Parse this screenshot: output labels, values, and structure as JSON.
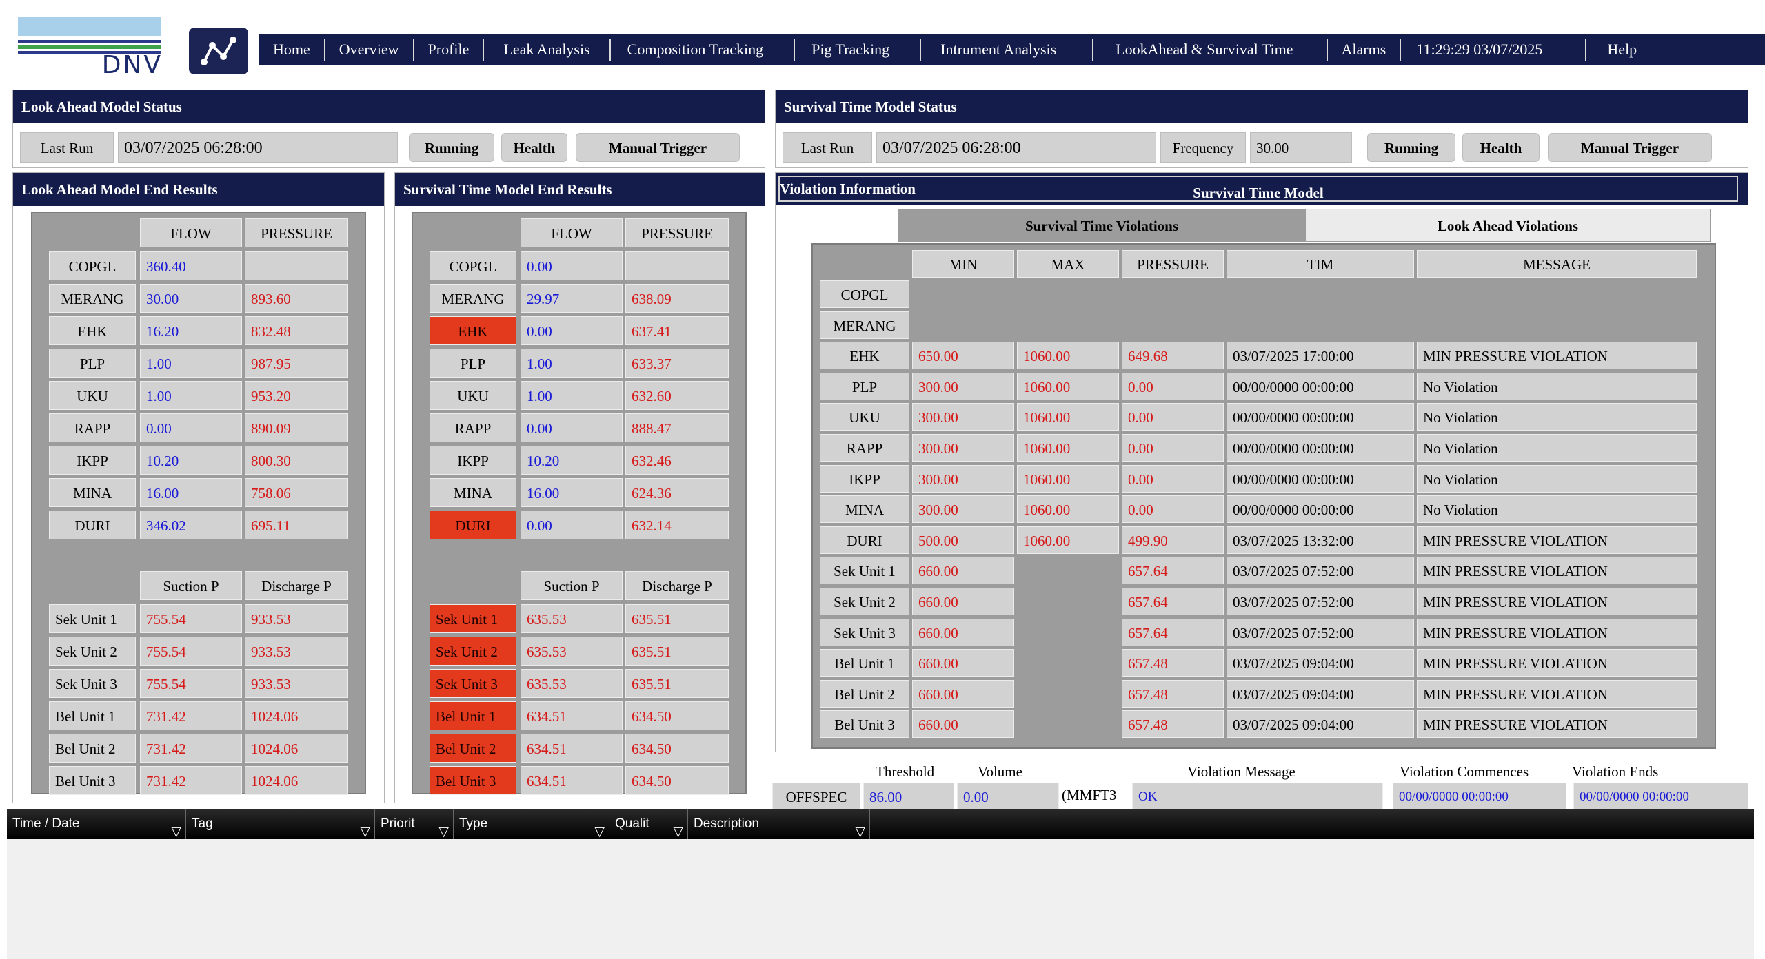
{
  "logo": {
    "text": "DNV"
  },
  "nav": [
    "Home",
    "Overview",
    "Profile",
    "Leak Analysis",
    "Composition Tracking",
    "Pig Tracking",
    "Intrument Analysis",
    "LookAhead & Survival Time",
    "Alarms",
    "11:29:29 03/07/2025",
    "Help"
  ],
  "la_status": {
    "title": "Look Ahead Model Status",
    "last_run_label": "Last Run",
    "last_run": "03/07/2025 06:28:00",
    "running": "Running",
    "health": "Health",
    "manual_trigger": "Manual Trigger"
  },
  "st_status": {
    "title": "Survival Time Model Status",
    "last_run_label": "Last Run",
    "last_run": "03/07/2025 06:28:00",
    "frequency_label": "Frequency",
    "frequency": "30.00",
    "running": "Running",
    "health": "Health",
    "manual_trigger": "Manual Trigger"
  },
  "la_results": {
    "title": "Look Ahead Model End Results",
    "flow_header": "FLOW",
    "pressure_header": "PRESSURE",
    "rows": [
      {
        "name": "COPGL",
        "flow": "360.40",
        "pressure": "",
        "alarm": false
      },
      {
        "name": "MERANG",
        "flow": "30.00",
        "pressure": "893.60",
        "alarm": false
      },
      {
        "name": "EHK",
        "flow": "16.20",
        "pressure": "832.48",
        "alarm": false
      },
      {
        "name": "PLP",
        "flow": "1.00",
        "pressure": "987.95",
        "alarm": false
      },
      {
        "name": "UKU",
        "flow": "1.00",
        "pressure": "953.20",
        "alarm": false
      },
      {
        "name": "RAPP",
        "flow": "0.00",
        "pressure": "890.09",
        "alarm": false
      },
      {
        "name": "IKPP",
        "flow": "10.20",
        "pressure": "800.30",
        "alarm": false
      },
      {
        "name": "MINA",
        "flow": "16.00",
        "pressure": "758.06",
        "alarm": false
      },
      {
        "name": "DURI",
        "flow": "346.02",
        "pressure": "695.11",
        "alarm": false
      }
    ],
    "suction_header": "Suction P",
    "discharge_header": "Discharge P",
    "units": [
      {
        "name": "Sek Unit 1",
        "suction": "755.54",
        "discharge": "933.53",
        "alarm": false
      },
      {
        "name": "Sek Unit 2",
        "suction": "755.54",
        "discharge": "933.53",
        "alarm": false
      },
      {
        "name": "Sek Unit 3",
        "suction": "755.54",
        "discharge": "933.53",
        "alarm": false
      },
      {
        "name": "Bel Unit 1",
        "suction": "731.42",
        "discharge": "1024.06",
        "alarm": false
      },
      {
        "name": "Bel Unit 2",
        "suction": "731.42",
        "discharge": "1024.06",
        "alarm": false
      },
      {
        "name": "Bel Unit 3",
        "suction": "731.42",
        "discharge": "1024.06",
        "alarm": false
      }
    ]
  },
  "st_results": {
    "title": "Survival Time Model End Results",
    "flow_header": "FLOW",
    "pressure_header": "PRESSURE",
    "rows": [
      {
        "name": "COPGL",
        "flow": "0.00",
        "pressure": "",
        "alarm": false
      },
      {
        "name": "MERANG",
        "flow": "29.97",
        "pressure": "638.09",
        "alarm": false
      },
      {
        "name": "EHK",
        "flow": "0.00",
        "pressure": "637.41",
        "alarm": true
      },
      {
        "name": "PLP",
        "flow": "1.00",
        "pressure": "633.37",
        "alarm": false
      },
      {
        "name": "UKU",
        "flow": "1.00",
        "pressure": "632.60",
        "alarm": false
      },
      {
        "name": "RAPP",
        "flow": "0.00",
        "pressure": "888.47",
        "alarm": false
      },
      {
        "name": "IKPP",
        "flow": "10.20",
        "pressure": "632.46",
        "alarm": false
      },
      {
        "name": "MINA",
        "flow": "16.00",
        "pressure": "624.36",
        "alarm": false
      },
      {
        "name": "DURI",
        "flow": "0.00",
        "pressure": "632.14",
        "alarm": true
      }
    ],
    "suction_header": "Suction P",
    "discharge_header": "Discharge P",
    "units": [
      {
        "name": "Sek Unit 1",
        "suction": "635.53",
        "discharge": "635.51",
        "alarm": true
      },
      {
        "name": "Sek Unit 2",
        "suction": "635.53",
        "discharge": "635.51",
        "alarm": true
      },
      {
        "name": "Sek Unit 3",
        "suction": "635.53",
        "discharge": "635.51",
        "alarm": true
      },
      {
        "name": "Bel Unit 1",
        "suction": "634.51",
        "discharge": "634.50",
        "alarm": true
      },
      {
        "name": "Bel Unit 2",
        "suction": "634.51",
        "discharge": "634.50",
        "alarm": true
      },
      {
        "name": "Bel Unit 3",
        "suction": "634.51",
        "discharge": "634.50",
        "alarm": true
      }
    ]
  },
  "violation": {
    "title": "Violation Information",
    "model_label": "Survival Time Model",
    "tab_active": "Survival Time Violations",
    "tab_inactive": "Look Ahead Violations",
    "headers": [
      "MIN",
      "MAX",
      "PRESSURE",
      "TIM",
      "MESSAGE"
    ],
    "rows": [
      {
        "name": "COPGL",
        "min": "",
        "max": "",
        "pressure": "",
        "time": "",
        "message": ""
      },
      {
        "name": "MERANG",
        "min": "",
        "max": "",
        "pressure": "",
        "time": "",
        "message": ""
      },
      {
        "name": "EHK",
        "min": "650.00",
        "max": "1060.00",
        "pressure": "649.68",
        "time": "03/07/2025 17:00:00",
        "message": "MIN PRESSURE VIOLATION"
      },
      {
        "name": "PLP",
        "min": "300.00",
        "max": "1060.00",
        "pressure": "0.00",
        "time": "00/00/0000 00:00:00",
        "message": "No Violation"
      },
      {
        "name": "UKU",
        "min": "300.00",
        "max": "1060.00",
        "pressure": "0.00",
        "time": "00/00/0000 00:00:00",
        "message": "No Violation"
      },
      {
        "name": "RAPP",
        "min": "300.00",
        "max": "1060.00",
        "pressure": "0.00",
        "time": "00/00/0000 00:00:00",
        "message": "No Violation"
      },
      {
        "name": "IKPP",
        "min": "300.00",
        "max": "1060.00",
        "pressure": "0.00",
        "time": "00/00/0000 00:00:00",
        "message": "No Violation"
      },
      {
        "name": "MINA",
        "min": "300.00",
        "max": "1060.00",
        "pressure": "0.00",
        "time": "00/00/0000 00:00:00",
        "message": "No Violation"
      },
      {
        "name": "DURI",
        "min": "500.00",
        "max": "1060.00",
        "pressure": "499.90",
        "time": "03/07/2025 13:32:00",
        "message": "MIN PRESSURE VIOLATION"
      },
      {
        "name": "Sek Unit 1",
        "min": "660.00",
        "max": "",
        "pressure": "657.64",
        "time": "03/07/2025 07:52:00",
        "message": "MIN PRESSURE VIOLATION"
      },
      {
        "name": "Sek Unit 2",
        "min": "660.00",
        "max": "",
        "pressure": "657.64",
        "time": "03/07/2025 07:52:00",
        "message": "MIN PRESSURE VIOLATION"
      },
      {
        "name": "Sek Unit 3",
        "min": "660.00",
        "max": "",
        "pressure": "657.64",
        "time": "03/07/2025 07:52:00",
        "message": "MIN PRESSURE VIOLATION"
      },
      {
        "name": "Bel Unit 1",
        "min": "660.00",
        "max": "",
        "pressure": "657.48",
        "time": "03/07/2025 09:04:00",
        "message": "MIN PRESSURE VIOLATION"
      },
      {
        "name": "Bel Unit 2",
        "min": "660.00",
        "max": "",
        "pressure": "657.48",
        "time": "03/07/2025 09:04:00",
        "message": "MIN PRESSURE VIOLATION"
      },
      {
        "name": "Bel Unit 3",
        "min": "660.00",
        "max": "",
        "pressure": "657.48",
        "time": "03/07/2025 09:04:00",
        "message": "MIN PRESSURE VIOLATION"
      }
    ]
  },
  "offspec": {
    "label": "OFFSPEC",
    "threshold_label": "Threshold",
    "threshold": "86.00",
    "volume_label": "Volume",
    "volume": "0.00",
    "unit": "(MMFT3",
    "message_label": "Violation Message",
    "message": "OK",
    "commences_label": "Violation Commences",
    "commences": "00/00/0000 00:00:00",
    "ends_label": "Violation Ends",
    "ends": "00/00/0000 00:00:00"
  },
  "alarms": {
    "columns": [
      "Time / Date",
      "Tag",
      "Priorit",
      "Type",
      "Qualit",
      "Description"
    ]
  },
  "colors": {
    "navy": "#131c4a",
    "cell": "#d2d2d2",
    "grid": "#9c9c9c",
    "alarm": "#e3391c",
    "flow_text": "#1a1ad6",
    "pressure_text": "#d61a1a"
  }
}
